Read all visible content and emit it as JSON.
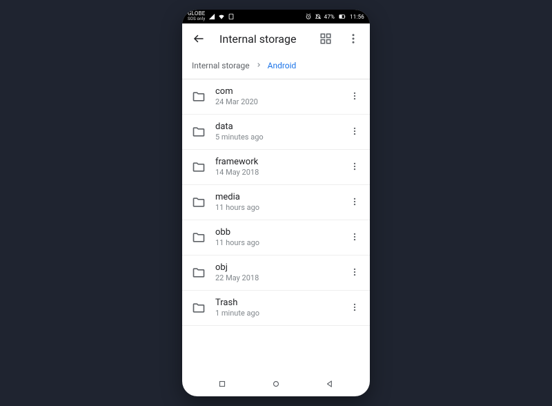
{
  "statusbar": {
    "carrier_top": "GLOBE",
    "carrier_sub": "SOS only",
    "battery_pct": "47%",
    "time": "11:56"
  },
  "appbar": {
    "title": "Internal storage"
  },
  "breadcrumb": {
    "root": "Internal storage",
    "current": "Android"
  },
  "folders": [
    {
      "name": "com",
      "sub": "24 Mar 2020"
    },
    {
      "name": "data",
      "sub": "5 minutes ago"
    },
    {
      "name": "framework",
      "sub": "14 May 2018"
    },
    {
      "name": "media",
      "sub": "11 hours ago"
    },
    {
      "name": "obb",
      "sub": "11 hours ago"
    },
    {
      "name": "obj",
      "sub": "22 May 2018"
    },
    {
      "name": "Trash",
      "sub": "1 minute ago"
    }
  ]
}
